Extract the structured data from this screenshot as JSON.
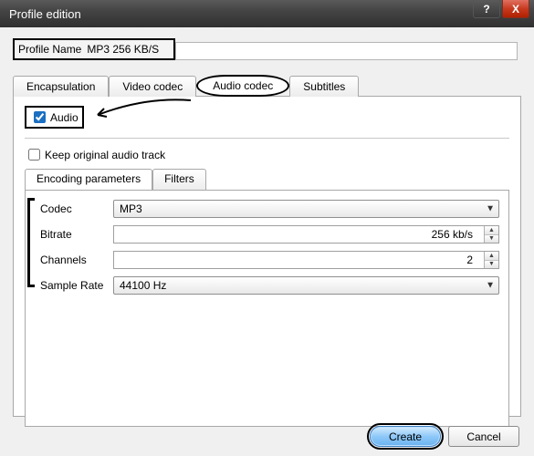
{
  "window": {
    "title": "Profile edition",
    "help_icon": "?",
    "close_icon": "X"
  },
  "profile": {
    "label": "Profile Name",
    "value": "MP3 256 KB/S"
  },
  "tabs": {
    "encapsulation": "Encapsulation",
    "video_codec": "Video codec",
    "audio_codec": "Audio codec",
    "subtitles": "Subtitles"
  },
  "audio_panel": {
    "audio_checkbox": {
      "label": "Audio",
      "checked": true
    },
    "keep_original": {
      "label": "Keep original audio track",
      "checked": false
    },
    "subtabs": {
      "encoding": "Encoding parameters",
      "filters": "Filters"
    },
    "fields": {
      "codec": {
        "label": "Codec",
        "value": "MP3"
      },
      "bitrate": {
        "label": "Bitrate",
        "value": "256 kb/s"
      },
      "channels": {
        "label": "Channels",
        "value": "2"
      },
      "sample_rate": {
        "label": "Sample Rate",
        "value": "44100 Hz"
      }
    }
  },
  "footer": {
    "create": "Create",
    "cancel": "Cancel"
  }
}
